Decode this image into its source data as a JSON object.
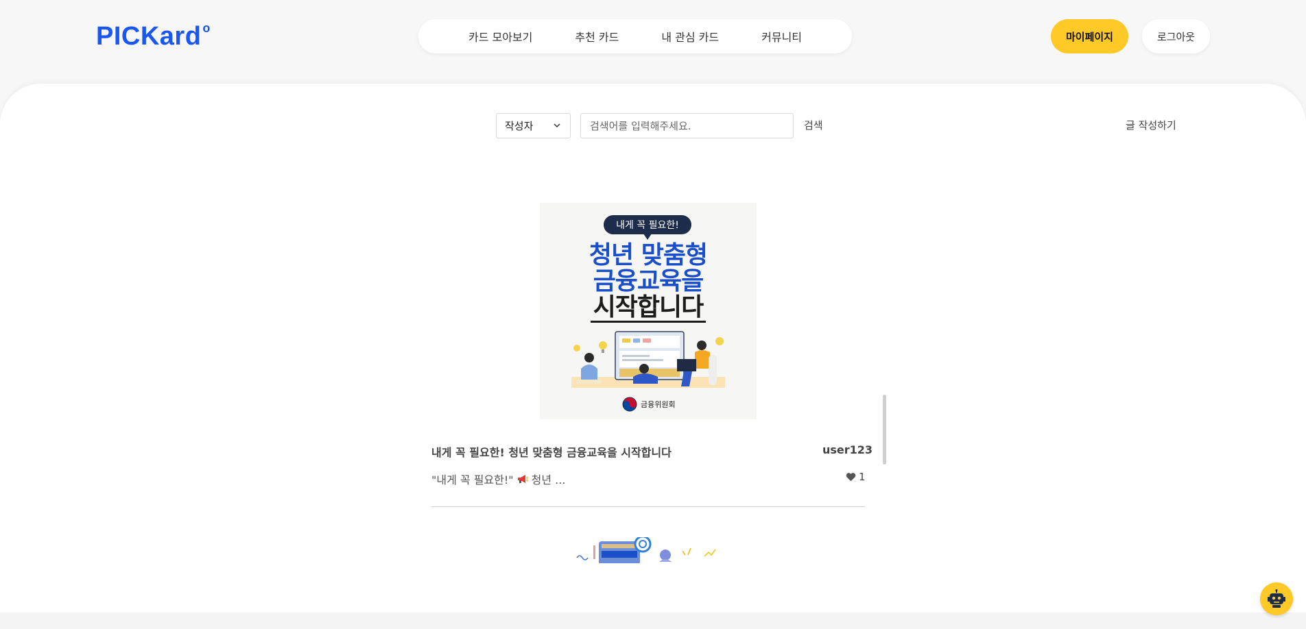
{
  "header": {
    "logo": "PICKard",
    "logo_mark": "o",
    "nav": [
      {
        "label": "카드 모아보기"
      },
      {
        "label": "추천 카드"
      },
      {
        "label": "내 관심 카드"
      },
      {
        "label": "커뮤니티"
      }
    ],
    "mypage_label": "마이페이지",
    "logout_label": "로그아웃"
  },
  "search": {
    "filter_selected": "작성자",
    "placeholder": "검색어를 입력해주세요.",
    "search_label": "검색",
    "write_label": "글 작성하기"
  },
  "posts": [
    {
      "image": {
        "bubble": "내게 꼭 필요한!",
        "line1": "청년 맞춤형",
        "line2": "금융교육을",
        "line3": "시작합니다",
        "org": "금융위원회"
      },
      "title": "내게 꼭 필요한! 청년 맞춤형 금융교육을 시작합니다",
      "author": "user123",
      "excerpt_quote": "\"내게 꼭 필요한!\"",
      "excerpt_rest": "청년 ...",
      "likes": "1"
    }
  ],
  "colors": {
    "brand": "#1a57f2",
    "accent": "#ffc928",
    "poster_blue": "#1b4fc9",
    "poster_navy": "#1d2c4a"
  },
  "icons": {
    "select_chevron": "chevron-down-icon",
    "like": "heart-icon",
    "megaphone": "megaphone-icon",
    "chatbot": "robot-icon"
  }
}
